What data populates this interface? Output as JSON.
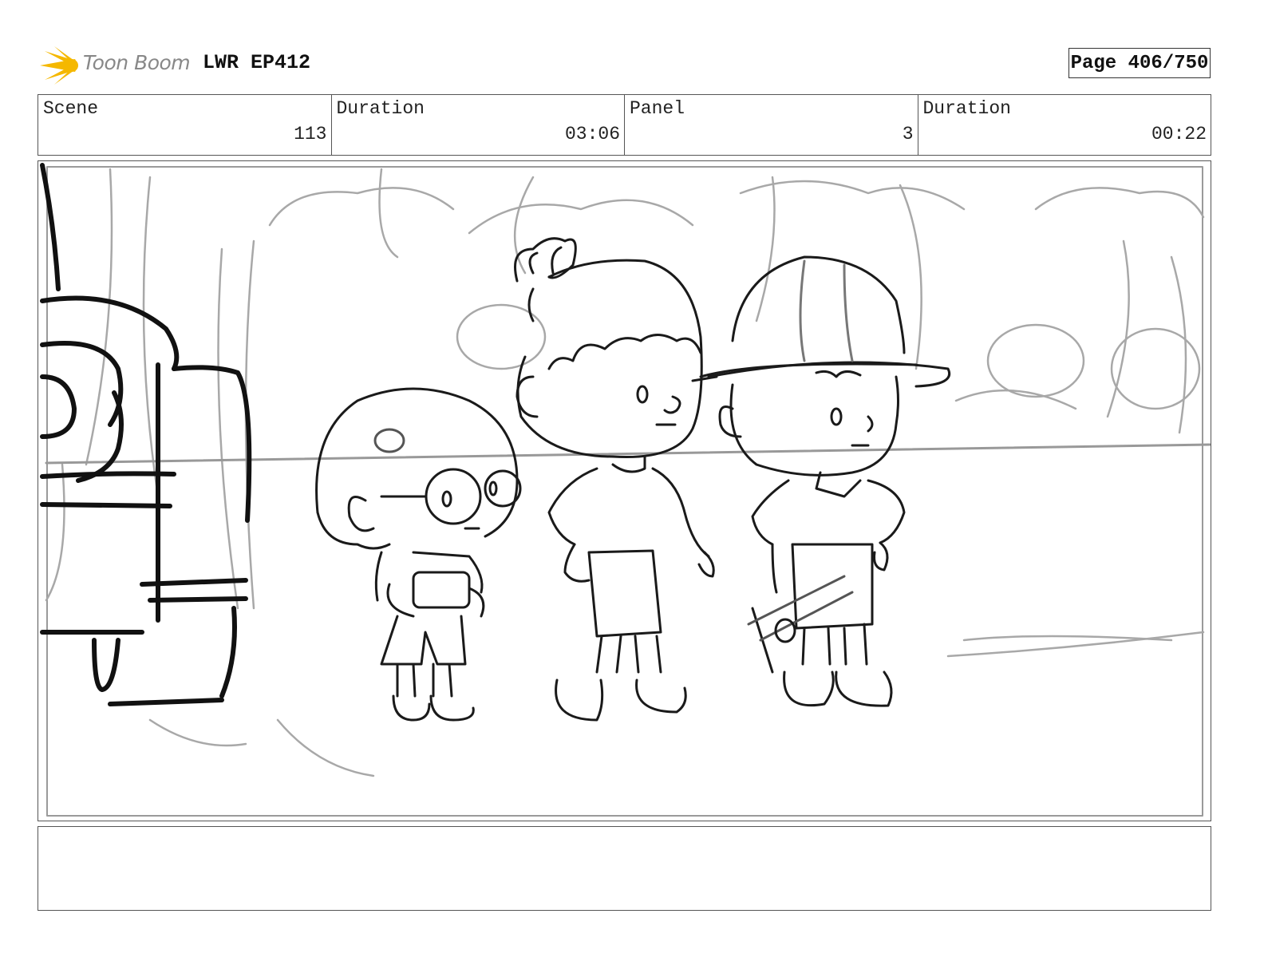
{
  "header": {
    "logo_text": "Toon Boom",
    "project_title": "LWR EP412",
    "page_label": "Page 406/750"
  },
  "info": [
    {
      "label": "Scene",
      "value": "113"
    },
    {
      "label": "Duration",
      "value": "03:06"
    },
    {
      "label": "Panel",
      "value": "3"
    },
    {
      "label": "Duration",
      "value": "00:22"
    }
  ],
  "notes": {
    "text": ""
  },
  "colors": {
    "logo_flame": "#f5b800",
    "sketch_light": "#a6a6a6",
    "sketch_dark": "#111111"
  }
}
